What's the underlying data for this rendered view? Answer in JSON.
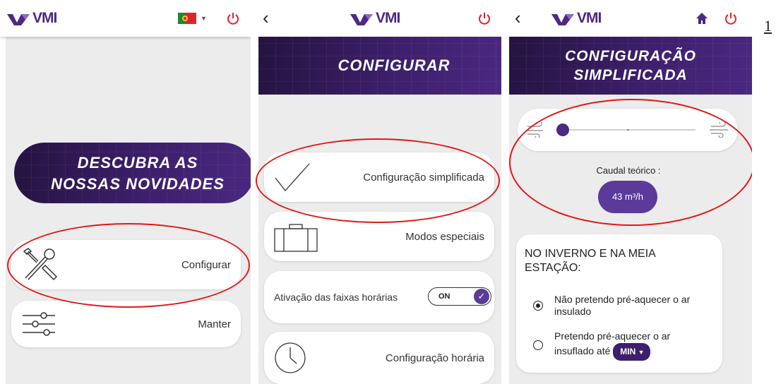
{
  "brand": {
    "name": "VMI",
    "accent": "#4b2a83",
    "power_color": "#e21e2b",
    "highlight_color": "#e01818"
  },
  "screen1": {
    "banner": {
      "line1": "DESCUBRA AS",
      "line2": "NOSSAS NOVIDADES"
    },
    "menu": [
      {
        "label": "Configurar",
        "icon": "tools-icon"
      },
      {
        "label": "Manter",
        "icon": "sliders-icon"
      }
    ]
  },
  "screen2": {
    "title": "CONFIGURAR",
    "menu": [
      {
        "label": "Configuração simplificada",
        "icon": "check-icon"
      },
      {
        "label": "Modos especiais",
        "icon": "suitcase-icon"
      }
    ],
    "toggle": {
      "label": "Ativação das faixas horárias",
      "state": "ON"
    },
    "schedule": {
      "label": "Configuração horária",
      "icon": "clock-icon"
    }
  },
  "screen3": {
    "title_line1": "CONFIGURAÇÃO",
    "title_line2": "SIMPLIFICADA",
    "flow": {
      "label": "Caudal teórico :",
      "value": "43 m³/h",
      "slider_position": 0.03
    },
    "winter": {
      "heading_line1": "NO INVERNO E NA MEIA",
      "heading_line2": "ESTAÇÃO:",
      "option1_line1": "Não pretendo pré-aquecer o ar",
      "option1_line2": "insulado",
      "option2_line1": "Pretendo pré-aquecer o ar",
      "option2_line2": "insuflado até",
      "option2_value": "MIN"
    }
  },
  "page_number": "1"
}
